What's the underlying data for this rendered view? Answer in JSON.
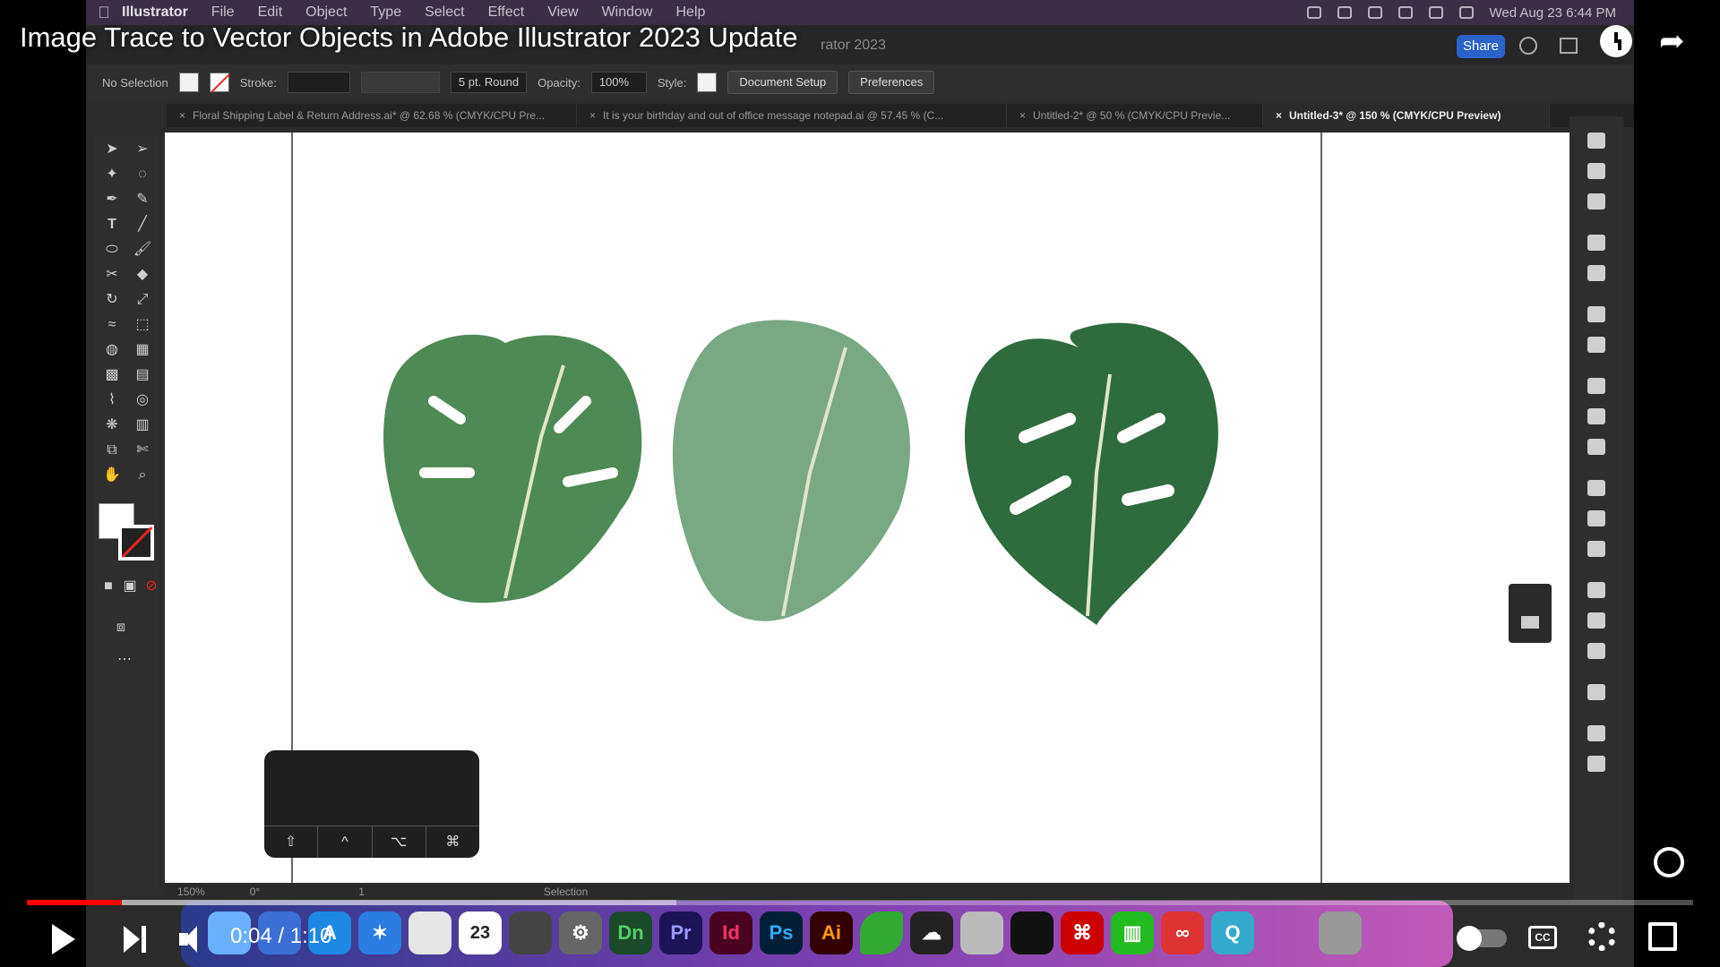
{
  "video": {
    "title": "Image Trace to Vector Objects in Adobe Illustrator 2023 Update",
    "time": "0:04 / 1:10",
    "progress_fraction": 0.057,
    "buffered_fraction": 0.39
  },
  "mac_menu": {
    "app": "Illustrator",
    "items": [
      "File",
      "Edit",
      "Object",
      "Type",
      "Select",
      "Effect",
      "View",
      "Window",
      "Help"
    ],
    "clock": "Wed Aug 23  6:44 PM"
  },
  "app_title": "rator 2023",
  "share_label": "Share",
  "control_bar": {
    "selection": "No Selection",
    "stroke_label": "Stroke:",
    "brush": "5 pt. Round",
    "opacity_label": "Opacity:",
    "opacity_value": "100%",
    "style_label": "Style:",
    "document_setup": "Document Setup",
    "preferences": "Preferences"
  },
  "doc_tabs": [
    {
      "label": "Floral Shipping Label & Return Address.ai* @ 62.68 % (CMYK/CPU Pre..."
    },
    {
      "label": "It is your birthday and out of office message notepad.ai @ 57.45 % (C..."
    },
    {
      "label": "Untitled-2* @ 50 % (CMYK/CPU Previe..."
    },
    {
      "label": "Untitled-3* @ 150 % (CMYK/CPU Preview)"
    }
  ],
  "status_bar": {
    "zoom": "150%",
    "rotation": "0°",
    "artboard": "1",
    "tool": "Selection"
  },
  "key_overlay": {
    "keys": [
      "⇧",
      "^",
      "⌥",
      "⌘"
    ]
  },
  "leaf_colors": {
    "leaf1": "#4e8a55",
    "leaf2": "#79a885",
    "leaf3": "#2e6b3f",
    "vein": "#dfe7c8"
  },
  "dock": {
    "apps": [
      {
        "label": "Dn",
        "color": "#1a4a2a"
      },
      {
        "label": "Pr",
        "color": "#1c1457"
      },
      {
        "label": "Id",
        "color": "#49021f"
      },
      {
        "label": "Ps",
        "color": "#001e36"
      },
      {
        "label": "Ai",
        "color": "#330000"
      }
    ],
    "calendar_month": "AUG",
    "calendar_day": "23"
  },
  "accent_colors": {
    "progress": "#ff0000",
    "share_button": "#2a62c9"
  }
}
